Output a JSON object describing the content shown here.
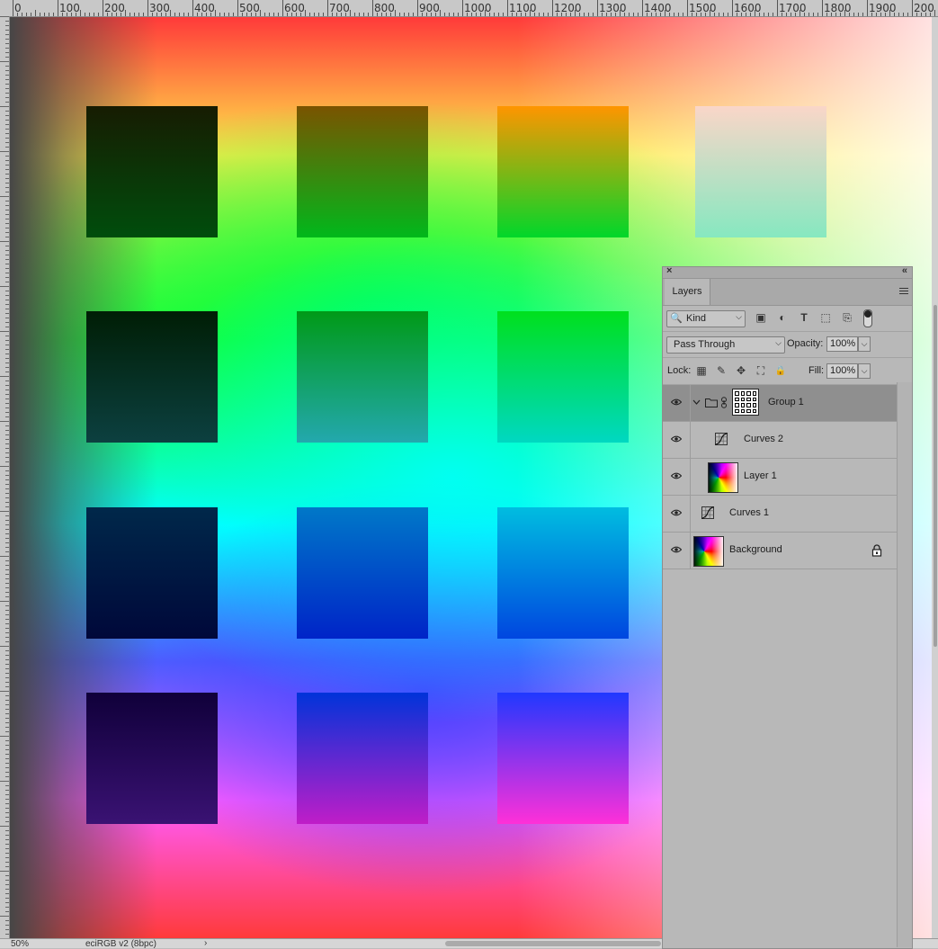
{
  "ruler": {
    "labels": [
      "0",
      "100",
      "200",
      "300",
      "400",
      "500",
      "600",
      "700",
      "800",
      "900",
      "1000",
      "1100",
      "1200",
      "1300",
      "1400",
      "1500",
      "1600",
      "1700",
      "1800",
      "1900",
      "200"
    ]
  },
  "canvas": {
    "swatches": [
      {
        "row": 0,
        "col": 0,
        "top": "#171c02",
        "bottom": "#004d0c"
      },
      {
        "row": 0,
        "col": 1,
        "top": "#7a5300",
        "bottom": "#00b81b"
      },
      {
        "row": 0,
        "col": 2,
        "top": "#ff9500",
        "bottom": "#00d72a"
      },
      {
        "row": 0,
        "col": 3,
        "top": "#fad6c8",
        "bottom": "#86e8c0"
      },
      {
        "row": 1,
        "col": 0,
        "top": "#001e05",
        "bottom": "#0c4040"
      },
      {
        "row": 1,
        "col": 1,
        "top": "#009a17",
        "bottom": "#23a8ae"
      },
      {
        "row": 1,
        "col": 2,
        "top": "#00e01d",
        "bottom": "#00d8c2"
      },
      {
        "row": 2,
        "col": 0,
        "top": "#00284a",
        "bottom": "#00083a"
      },
      {
        "row": 2,
        "col": 1,
        "top": "#0078c8",
        "bottom": "#0024c8"
      },
      {
        "row": 2,
        "col": 2,
        "top": "#00bde0",
        "bottom": "#0046e0"
      },
      {
        "row": 3,
        "col": 0,
        "top": "#10003a",
        "bottom": "#3a1273"
      },
      {
        "row": 3,
        "col": 1,
        "top": "#0033d9",
        "bottom": "#c01dc8"
      },
      {
        "row": 3,
        "col": 2,
        "top": "#2038ff",
        "bottom": "#ff30d8"
      }
    ]
  },
  "status": {
    "zoom": "50%",
    "profile": "eciRGB v2 (8bpc)",
    "arrow": "›"
  },
  "panel": {
    "tab_label": "Layers",
    "close_glyph": "×",
    "collapse_glyph": "«",
    "filter": {
      "kind_label": "Kind",
      "search_glyph": "🔍",
      "chevron": "⌵",
      "icons": {
        "pixel": "▣",
        "adjustment": "◐",
        "type": "T",
        "shape": "⬚",
        "smart_object": "⎘"
      }
    },
    "blend": {
      "mode": "Pass Through",
      "opacity_label": "Opacity:",
      "opacity_value": "100%",
      "chevron": "⌵"
    },
    "lock": {
      "label": "Lock:",
      "fill_label": "Fill:",
      "fill_value": "100%",
      "icons": {
        "transparent": "▦",
        "brush": "✎",
        "move": "✥",
        "artboard": "⛶",
        "all": "🔒"
      }
    },
    "layers": [
      {
        "name": "Group 1",
        "type": "group",
        "selected": true
      },
      {
        "name": "Curves 2",
        "type": "curves",
        "indent": 2
      },
      {
        "name": "Layer 1",
        "type": "pixel",
        "indent": 1
      },
      {
        "name": "Curves 1",
        "type": "curves",
        "indent": 0
      },
      {
        "name": "Background",
        "type": "pixel",
        "locked": true
      }
    ]
  }
}
